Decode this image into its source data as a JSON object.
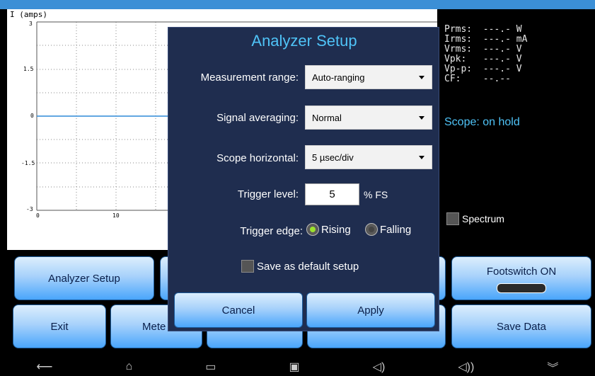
{
  "scope": {
    "title": "I (amps)",
    "y_ticks": [
      "3",
      "1.5",
      "0",
      "-1.5",
      "-3"
    ],
    "x_ticks": [
      "0",
      "10"
    ],
    "status": "Scope: on hold"
  },
  "readouts": [
    "Prms:  ---.- W",
    "Irms:  ---.- mA",
    "Vrms:  ---.- V",
    "Vpk:   ---.- V",
    "Vp-p:  ---.- V",
    "CF:    --.--"
  ],
  "spectrum": {
    "label": "Spectrum",
    "checked": false
  },
  "buttons": {
    "analyzer_setup": "Analyzer Setup",
    "footswitch": "Footswitch ON",
    "exit": "Exit",
    "meter": "Mete",
    "save_data": "Save Data"
  },
  "dialog": {
    "title": "Analyzer Setup",
    "measurement_range_label": "Measurement range:",
    "measurement_range_value": "Auto-ranging",
    "signal_averaging_label": "Signal averaging:",
    "signal_averaging_value": "Normal",
    "scope_horizontal_label": "Scope horizontal:",
    "scope_horizontal_value": "5 µsec/div",
    "trigger_level_label": "Trigger level:",
    "trigger_level_value": "5",
    "trigger_level_unit": "% FS",
    "trigger_edge_label": "Trigger edge:",
    "rising_label": "Rising",
    "falling_label": "Falling",
    "trigger_edge_selected": "Rising",
    "save_default_label": "Save as default setup",
    "cancel_label": "Cancel",
    "apply_label": "Apply"
  },
  "navbar": {
    "back_icon": "⟵",
    "home_icon": "⌂",
    "recents_icon": "▭",
    "screenshot_icon": "▣",
    "volume_down_icon": "◁)",
    "volume_up_icon": "◁))",
    "menu_icon": "︾"
  },
  "colors": {
    "top_bar": "#3b8fd6",
    "dialog_bg": "#1f2d4f",
    "accent": "#4fc3f7",
    "radio_selected": "#9be22d"
  }
}
